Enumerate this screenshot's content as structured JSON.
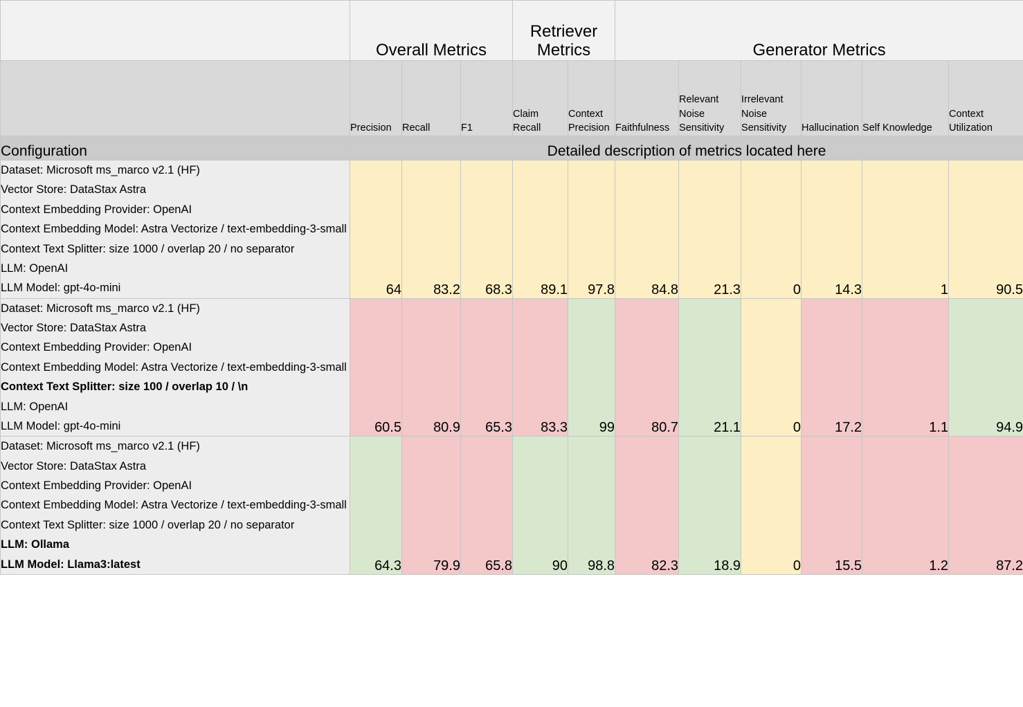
{
  "table": {
    "group_headers": [
      {
        "label": "",
        "span": 1
      },
      {
        "label": "Overall Metrics",
        "span": 3
      },
      {
        "label": "Retriever Metrics",
        "span": 2
      },
      {
        "label": "Generator Metrics",
        "span": 6
      }
    ],
    "metric_headers": [
      "Precision",
      "Recall",
      "F1",
      "Claim Recall",
      "Context Precision",
      "Faithfulness",
      "Relevant Noise Sensitivity",
      "Irrelevant Noise Sensitivity",
      "Hallucination",
      "Self Knowledge",
      "Context Utilization"
    ],
    "config_header": "Configuration",
    "description_header": "Detailed description of metrics located here",
    "rows": [
      {
        "config_lines": [
          {
            "text": "Dataset: Microsoft ms_marco v2.1 (HF)",
            "bold": false
          },
          {
            "text": "Vector Store: DataStax Astra",
            "bold": false
          },
          {
            "text": "Context Embedding Provider: OpenAI",
            "bold": false
          },
          {
            "text": "Context Embedding Model: Astra Vectorize / text-embedding-3-small",
            "bold": false
          },
          {
            "text": "Context Text Splitter: size 1000 / overlap 20 / no separator",
            "bold": false
          },
          {
            "text": "LLM: OpenAI",
            "bold": false
          },
          {
            "text": "LLM Model: gpt-4o-mini",
            "bold": false
          }
        ],
        "values": [
          "64",
          "83.2",
          "68.3",
          "89.1",
          "97.8",
          "84.8",
          "21.3",
          "0",
          "14.3",
          "1",
          "90.5"
        ],
        "colors": [
          "yellow",
          "yellow",
          "yellow",
          "yellow",
          "yellow",
          "yellow",
          "yellow",
          "yellow",
          "yellow",
          "yellow",
          "yellow"
        ]
      },
      {
        "config_lines": [
          {
            "text": "Dataset: Microsoft ms_marco v2.1 (HF)",
            "bold": false
          },
          {
            "text": "Vector Store: DataStax Astra",
            "bold": false
          },
          {
            "text": "Context Embedding Provider: OpenAI",
            "bold": false
          },
          {
            "text": "Context Embedding Model: Astra Vectorize / text-embedding-3-small",
            "bold": false
          },
          {
            "text": "Context Text Splitter: size 100 / overlap 10 / \\n",
            "bold": true
          },
          {
            "text": "LLM: OpenAI",
            "bold": false
          },
          {
            "text": "LLM Model: gpt-4o-mini",
            "bold": false
          }
        ],
        "values": [
          "60.5",
          "80.9",
          "65.3",
          "83.3",
          "99",
          "80.7",
          "21.1",
          "0",
          "17.2",
          "1.1",
          "94.9"
        ],
        "colors": [
          "pink",
          "pink",
          "pink",
          "pink",
          "green",
          "pink",
          "green",
          "yellow",
          "pink",
          "pink",
          "green"
        ]
      },
      {
        "config_lines": [
          {
            "text": "Dataset: Microsoft ms_marco v2.1 (HF)",
            "bold": false
          },
          {
            "text": "Vector Store: DataStax Astra",
            "bold": false
          },
          {
            "text": "Context Embedding Provider: OpenAI",
            "bold": false
          },
          {
            "text": "Context Embedding Model: Astra Vectorize / text-embedding-3-small",
            "bold": false
          },
          {
            "text": "Context Text Splitter: size 1000 / overlap 20 / no separator",
            "bold": false
          },
          {
            "text": "LLM: Ollama",
            "bold": true
          },
          {
            "text": "LLM Model: Llama3:latest",
            "bold": true
          }
        ],
        "values": [
          "64.3",
          "79.9",
          "65.8",
          "90",
          "98.8",
          "82.3",
          "18.9",
          "0",
          "15.5",
          "1.2",
          "87.2"
        ],
        "colors": [
          "green",
          "pink",
          "pink",
          "green",
          "green",
          "pink",
          "green",
          "yellow",
          "pink",
          "pink",
          "pink"
        ]
      }
    ],
    "palette": {
      "yellow": "#fdefc3",
      "pink": "#f4c7c9",
      "green": "#d8e8ce",
      "header_group_bg": "#f2f2f2",
      "header_metric_bg": "#d9d9d9",
      "config_band_bg": "#cbcbcb",
      "config_cell_bg": "#ededed",
      "border": "#c6c6c6"
    }
  }
}
